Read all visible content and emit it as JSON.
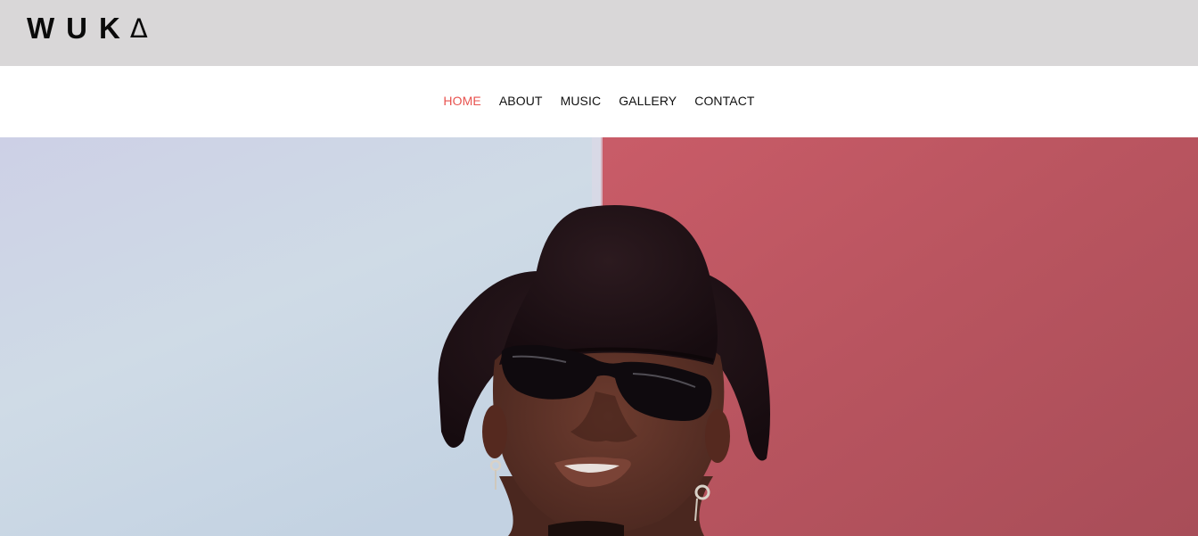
{
  "brand": {
    "logo_letters": "WUK",
    "logo_mark": "Δ"
  },
  "nav": {
    "active_color": "#e8534f",
    "items": [
      {
        "label": "HOME",
        "active": true
      },
      {
        "label": "ABOUT",
        "active": false
      },
      {
        "label": "MUSIC",
        "active": false
      },
      {
        "label": "GALLERY",
        "active": false
      },
      {
        "label": "CONTACT",
        "active": false
      }
    ]
  },
  "hero": {
    "left_backdrop_color": "#cfdbe6",
    "right_backdrop_color": "#b8545f",
    "hat_color": "#1e1216",
    "skin_color": "#5a3126"
  },
  "colors": {
    "topbar": "#d9d7d8",
    "text": "#111111"
  }
}
